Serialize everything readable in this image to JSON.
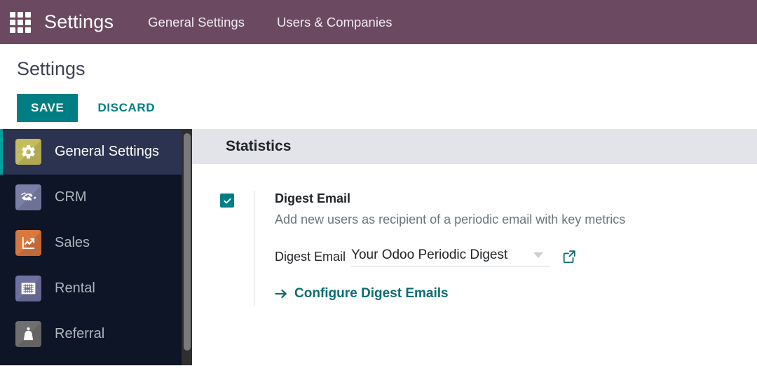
{
  "topbar": {
    "apps_icon": "apps-grid-icon",
    "brand": "Settings",
    "menus": [
      {
        "label": "General Settings"
      },
      {
        "label": "Users & Companies"
      }
    ],
    "background_color": "#6b4a61"
  },
  "page": {
    "title": "Settings",
    "save_label": "SAVE",
    "discard_label": "DISCARD",
    "accent_color": "#017e84"
  },
  "sidebar": {
    "background_color": "#0d1526",
    "active_background_color": "#2b3350",
    "active_marker_color": "#00a09d",
    "items": [
      {
        "label": "General Settings",
        "icon": "gear-icon",
        "icon_color": "#c5bc5e",
        "active": true
      },
      {
        "label": "CRM",
        "icon": "handshake-icon",
        "icon_color": "#7b7fa8",
        "active": false
      },
      {
        "label": "Sales",
        "icon": "chart-up-icon",
        "icon_color": "#d9773f",
        "active": false
      },
      {
        "label": "Rental",
        "icon": "calendar-icon",
        "icon_color": "#6f72a0",
        "active": false
      },
      {
        "label": "Referral",
        "icon": "cape-person-icon",
        "icon_color": "#6f6f6f",
        "active": false
      }
    ]
  },
  "main": {
    "section_title": "Statistics",
    "setting": {
      "checked": true,
      "title": "Digest Email",
      "description": "Add new users as recipient of a periodic email with key metrics",
      "field_label": "Digest Email",
      "select_value": "Your Odoo Periodic Digest",
      "caret_icon": "chevron-down-icon",
      "external_link_icon": "external-link-icon",
      "config_link_label": "Configure Digest Emails",
      "config_link_icon": "arrow-right-icon",
      "link_color": "#0e6d72"
    }
  }
}
